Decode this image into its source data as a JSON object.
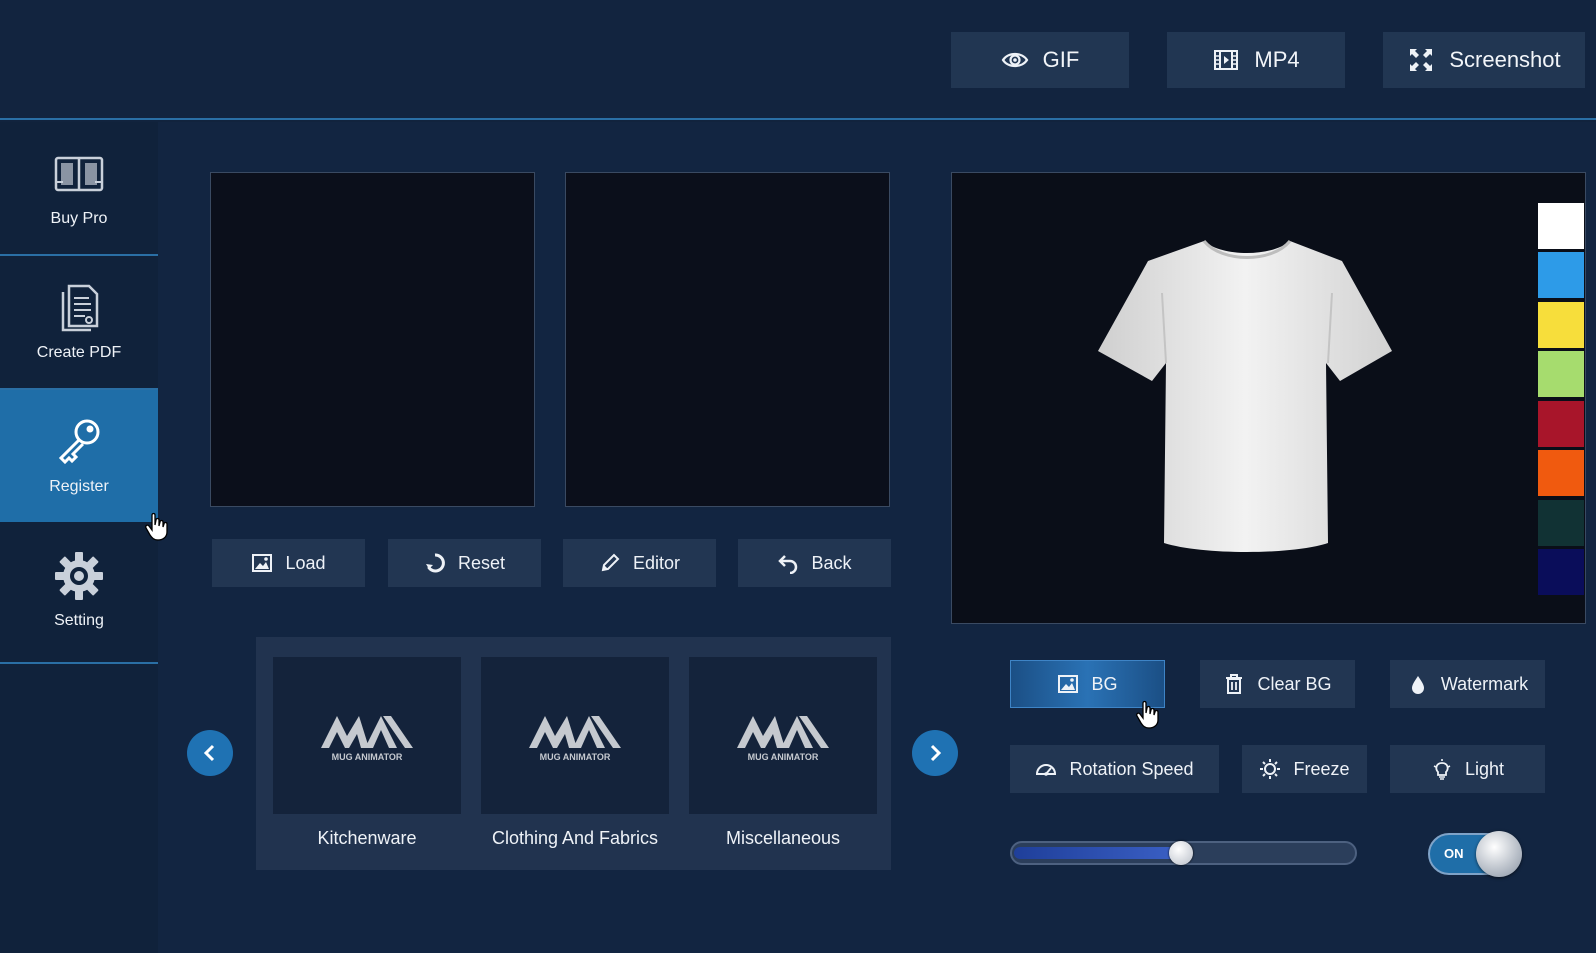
{
  "export": {
    "gif_label": "GIF",
    "mp4_label": "MP4",
    "screenshot_label": "Screenshot"
  },
  "sidebar": {
    "items": [
      {
        "label": "Buy Pro",
        "icon": "book-icon"
      },
      {
        "label": "Create PDF",
        "icon": "document-icon"
      },
      {
        "label": "Register",
        "icon": "key-icon",
        "active": true
      },
      {
        "label": "Setting",
        "icon": "gear-icon"
      }
    ]
  },
  "actions": {
    "load_label": "Load",
    "reset_label": "Reset",
    "editor_label": "Editor",
    "back_label": "Back"
  },
  "gallery": {
    "logo_text": "MUG ANIMATOR",
    "items": [
      {
        "label": "Kitchenware"
      },
      {
        "label": "Clothing And Fabrics"
      },
      {
        "label": "Miscellaneous"
      }
    ]
  },
  "stage": {
    "swatches": [
      "#ffffff",
      "#2d9be8",
      "#f7de3b",
      "#a6dc6e",
      "#a8152a",
      "#f05a0f",
      "#113234",
      "#0a0d5a"
    ]
  },
  "controls": {
    "bg_label": "BG",
    "clear_bg_label": "Clear BG",
    "watermark_label": "Watermark",
    "rotation_speed_label": "Rotation Speed",
    "freeze_label": "Freeze",
    "light_label": "Light",
    "rotation_speed_value": 0.48,
    "toggle_label": "ON"
  },
  "colors": {
    "accent": "#1f6ea8",
    "background": "#11233d",
    "button": "#223652"
  }
}
